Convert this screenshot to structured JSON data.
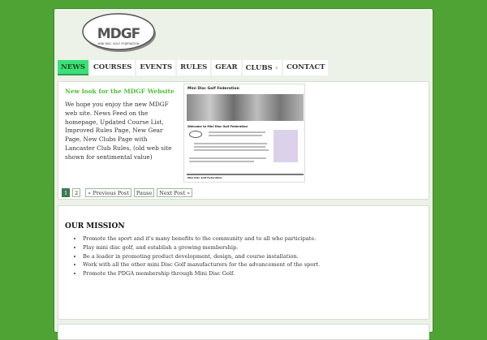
{
  "logo": {
    "text": "MDGF",
    "subtitle": "MINI DISC GOLF FEDERATION"
  },
  "nav": [
    {
      "label": "NEWS",
      "active": true
    },
    {
      "label": "COURSES"
    },
    {
      "label": "EVENTS"
    },
    {
      "label": "RULES"
    },
    {
      "label": "GEAR"
    },
    {
      "label": "CLUBS",
      "chevron": "»"
    },
    {
      "label": "CONTACT"
    }
  ],
  "slider": {
    "title": "New look for the MDGF Website",
    "body": "We hope you enjoy the new MDGF web site.  News Feed on the homepage, Updated Course List, Improved Rules Page, New Gear Page, New Clubs Page with Lancaster Club Rules, (old web site shown for sentimental value)",
    "screenshot": {
      "title": "Mini Disc Golf Federation",
      "heading": "Welcome to Mini Disc Golf Federation",
      "footer": "Mini Disc Golf Federation"
    },
    "pager": {
      "pages": [
        "1",
        "2"
      ],
      "prev": "« Previous Post",
      "pause": "Pause",
      "next": "Next Post »"
    }
  },
  "mission": {
    "title": "OUR MISSION",
    "items": [
      "Promote the sport and it's many benefits to the community and to all who participate.",
      "Play mini disc golf, and establish a growing membership.",
      "Be a leader in promoting product development, design, and course installation.",
      "Work with all the other mini Disc Golf manufacturers for the advancement of the sport.",
      "Promote the PDGA membership through Mini Disc Golf."
    ]
  }
}
